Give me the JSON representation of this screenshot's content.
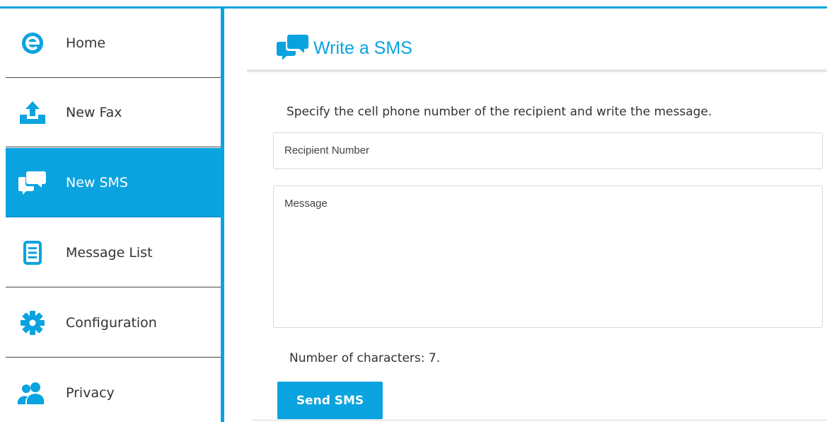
{
  "colors": {
    "accent": "#0aa3e0",
    "text": "#333333",
    "active_text": "#ffffff"
  },
  "sidebar": {
    "items": [
      {
        "label": "Home",
        "icon": "home-logo-icon",
        "active": false
      },
      {
        "label": "New Fax",
        "icon": "upload-icon",
        "active": false
      },
      {
        "label": "New SMS",
        "icon": "chat-bubbles-icon",
        "active": true
      },
      {
        "label": "Message List",
        "icon": "document-list-icon",
        "active": false
      },
      {
        "label": "Configuration",
        "icon": "gear-icon",
        "active": false
      },
      {
        "label": "Privacy",
        "icon": "users-icon",
        "active": false
      }
    ]
  },
  "main": {
    "title": "Write a SMS",
    "title_icon": "chat-bubbles-icon",
    "instructions": "Specify the cell phone number of the recipient and write the message.",
    "recipient": {
      "value": "Recipient Number"
    },
    "message": {
      "value": "Message"
    },
    "char_count": "Number of characters: 7.",
    "send_label": "Send SMS"
  }
}
